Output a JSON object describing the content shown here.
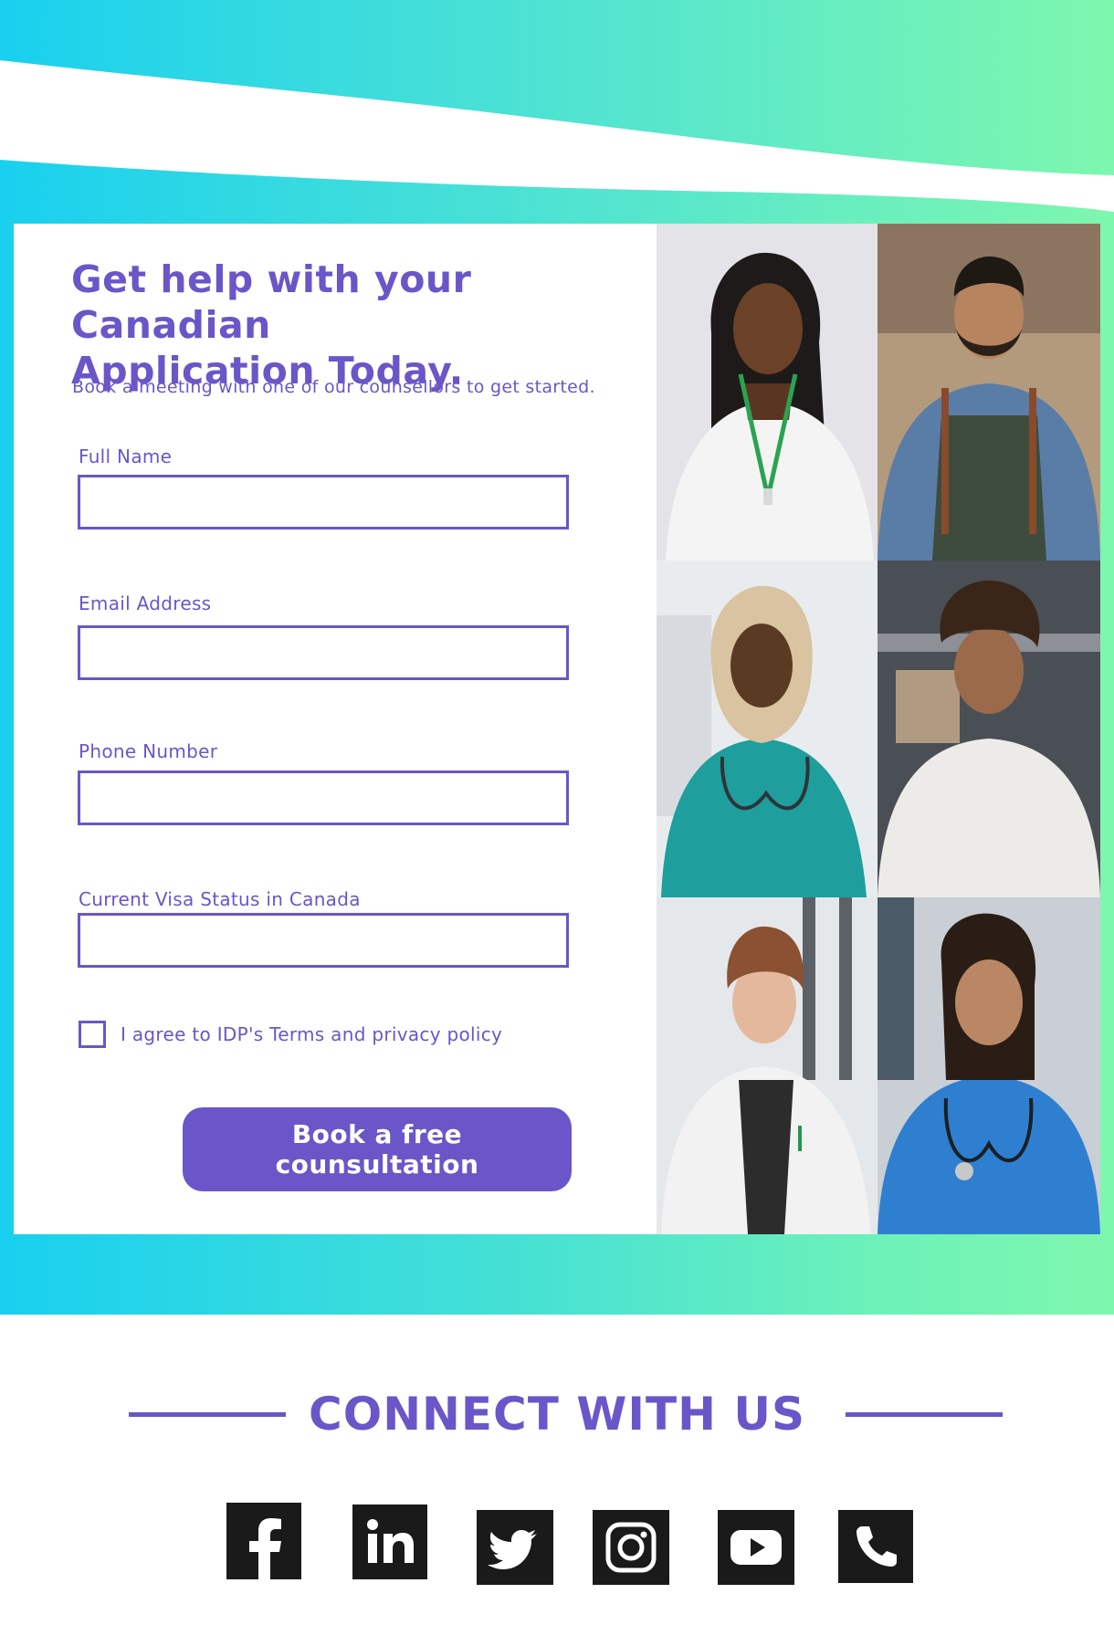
{
  "form": {
    "headline_line1": "Get help with your Canadian",
    "headline_line2": "Application Today.",
    "subtitle": "Book a meeting with one of our counsellors to get started.",
    "fields": [
      {
        "label": "Full Name",
        "value": "",
        "placeholder": ""
      },
      {
        "label": "Email Address",
        "value": "",
        "placeholder": ""
      },
      {
        "label": "Phone Number",
        "value": "",
        "placeholder": ""
      },
      {
        "label": "Current Visa Status in Canada",
        "value": "",
        "placeholder": ""
      }
    ],
    "agree_label": "I agree to IDP's Terms and privacy policy",
    "agree_checked": false,
    "submit_label": "Book a free counsultation"
  },
  "photos": [
    {
      "name": "woman-lanyard-photo"
    },
    {
      "name": "man-apron-photo"
    },
    {
      "name": "nurse-hijab-photo"
    },
    {
      "name": "chef-woman-photo"
    },
    {
      "name": "doctor-woman-photo"
    },
    {
      "name": "nurse-blue-scrubs-photo"
    }
  ],
  "connect": {
    "title": "CONNECT WITH US"
  },
  "social_icons": [
    "facebook-icon",
    "linkedin-icon",
    "twitter-icon",
    "instagram-icon",
    "youtube-icon",
    "phone-icon"
  ],
  "colors": {
    "brand_purple": "#6a56c9",
    "gradient_start": "#19d0ef",
    "gradient_end": "#7ef7ae"
  }
}
